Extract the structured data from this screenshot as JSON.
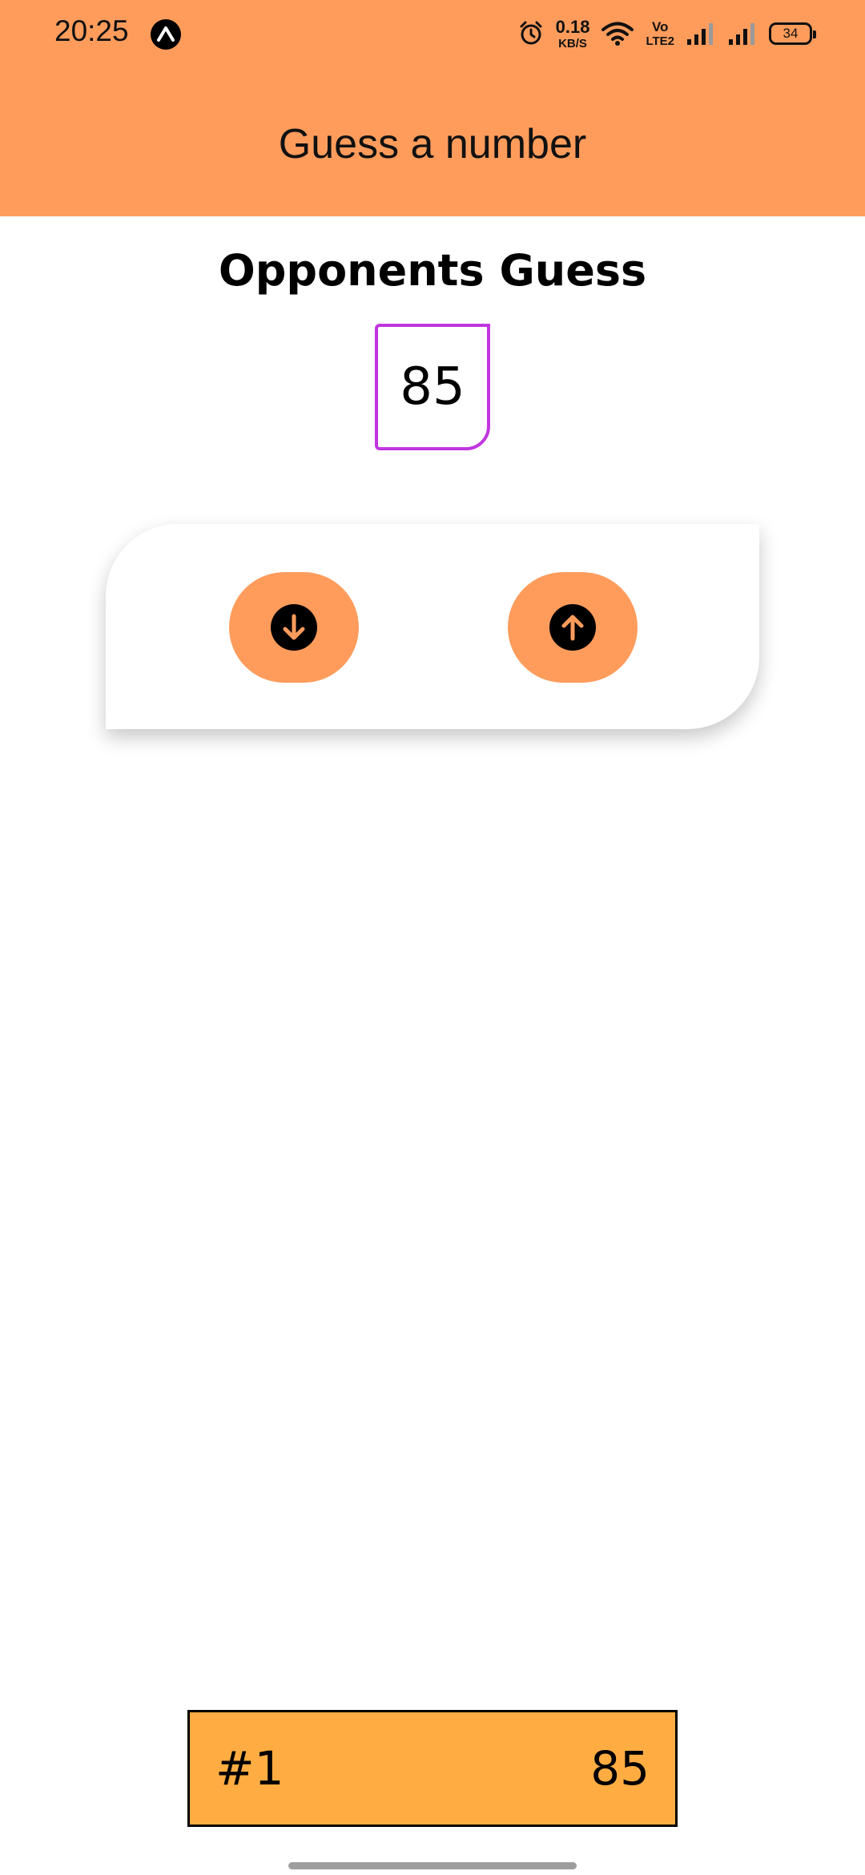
{
  "status_bar": {
    "time": "20:25",
    "net_speed_value": "0.18",
    "net_speed_unit": "KB/S",
    "volte_top": "Vo",
    "volte_bottom": "LTE2",
    "battery": "34",
    "icons": [
      "expo-icon",
      "alarm-icon",
      "wifi-icon",
      "signal-icon",
      "signal-icon",
      "battery-icon"
    ]
  },
  "header": {
    "title": "Guess a number",
    "background": "#ff9c5c"
  },
  "game": {
    "section_title": "Opponents Guess",
    "current_guess": "85",
    "guess_border_color": "#c036e0",
    "buttons": {
      "lower_icon": "arrow-down-circle-icon",
      "higher_icon": "arrow-up-circle-icon",
      "color": "#ff9c5c"
    }
  },
  "log": {
    "items": [
      {
        "round": "#1",
        "guess": "85"
      }
    ],
    "item_color": "#ffad42"
  }
}
